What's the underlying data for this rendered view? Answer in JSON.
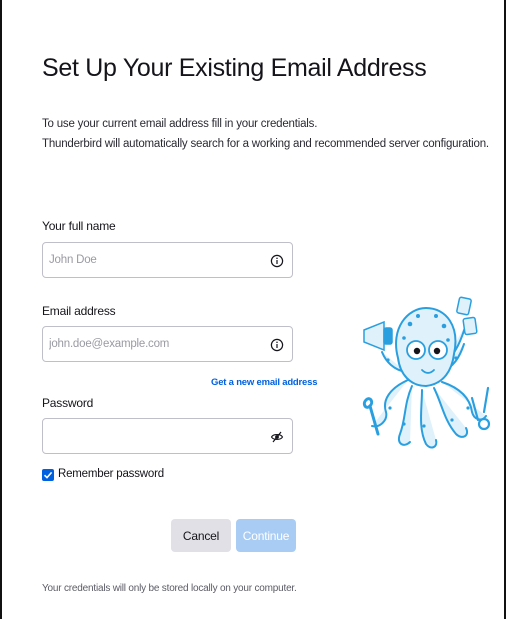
{
  "dialog": {
    "title": "Set Up Your Existing Email Address",
    "intro_line1": "To use your current email address fill in your credentials.",
    "intro_line2": "Thunderbird will automatically search for a working and recommended server configuration."
  },
  "form": {
    "name_label": "Your full name",
    "name_placeholder": "John Doe",
    "name_value": "",
    "email_label": "Email address",
    "email_placeholder": "john.doe@example.com",
    "email_value": "",
    "get_new_email_link": "Get a new email address",
    "password_label": "Password",
    "password_value": "",
    "remember_password_label": "Remember password",
    "remember_password_checked": true
  },
  "buttons": {
    "cancel_label": "Cancel",
    "continue_label": "Continue"
  },
  "footer": {
    "note": "Your credentials will only be stored locally on your computer."
  },
  "icons": {
    "info": "info-icon",
    "password_visibility": "eye-off-icon",
    "check": "check-icon",
    "mascot": "thunderbird-octopus-illustration"
  },
  "colors": {
    "accent": "#0061e0",
    "continue_disabled": "#a9ccf5",
    "cancel_bg": "#e0e0e6",
    "mascot_blue": "#2a9fe0",
    "mascot_light": "#dff1fb"
  }
}
